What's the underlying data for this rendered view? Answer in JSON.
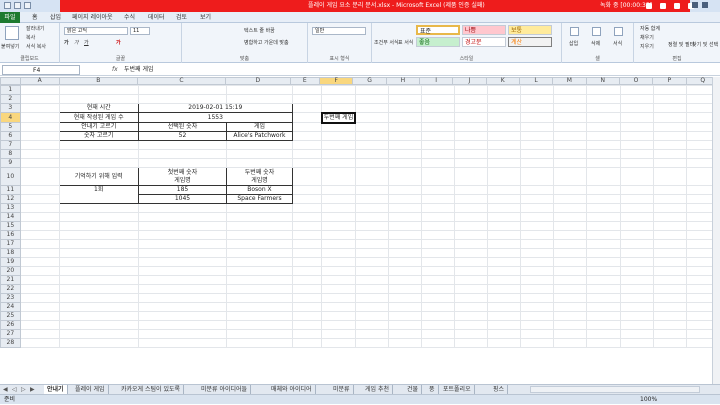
{
  "window": {
    "title": "플레이 게임 요소 분리 문서.xlsx  -  Microsoft Excel (제품 인증 실패)",
    "recording": "녹화 중 [00:00:35]"
  },
  "ribbon_tabs": [
    "파일",
    "홈",
    "삽입",
    "페이지 레이아웃",
    "수식",
    "데이터",
    "검토",
    "보기"
  ],
  "ribbon": {
    "clipboard": {
      "paste": "붙여넣기",
      "cut": "잘라내기",
      "copy": "복사",
      "format_painter": "서식 복사",
      "label": "클립보드"
    },
    "font": {
      "name": "맑은 고딕",
      "size": "11",
      "label": "글꼴"
    },
    "align": {
      "wrap": "텍스트 줄 바꿈",
      "merge": "병합하고 가운데 맞춤",
      "label": "맞춤"
    },
    "number": {
      "format": "일반",
      "label": "표시 형식"
    },
    "styles": {
      "cond": "조건부 서식",
      "table": "표 서식",
      "items": [
        "표준",
        "나쁨",
        "보통",
        "좋음",
        "경고문",
        "계산"
      ],
      "label": "스타일"
    },
    "cells": {
      "insert": "삽입",
      "delete": "삭제",
      "format": "서식",
      "label": "셀"
    },
    "edit": {
      "autosum": "자동 합계",
      "fill": "채우기",
      "clear": "지우기",
      "sort": "정렬 및 필터",
      "find": "찾기 및 선택",
      "label": "편집"
    }
  },
  "formula_bar": {
    "name_box": "F4",
    "fx": "fx",
    "value": "두번째 게임"
  },
  "columns": [
    "A",
    "B",
    "C",
    "D",
    "E",
    "F",
    "G",
    "H",
    "I",
    "J",
    "K",
    "L",
    "M",
    "N",
    "O",
    "P",
    "Q"
  ],
  "selected_column": "F",
  "selected_row": "4",
  "rows": {
    "r2": "2",
    "r3": "3",
    "r4": "4",
    "r5": "5",
    "r6": "6",
    "r10": "10",
    "r11": "11",
    "r12": "12"
  },
  "cells": {
    "B3": "현재 시간",
    "C3": "2019-02-01 15:19",
    "B4": "현재 작성된 게임 수",
    "C4": "1553",
    "B5": "안내기 고르기",
    "C5": "선택된 숫자",
    "D5": "게임",
    "B6": "숫자 고르기",
    "C6": "52",
    "D6": "Alice's Patchwork",
    "B10": "기억하기 위해 입력",
    "C10": "첫번째 숫자\n게임명",
    "D10": "두번째 숫자\n게임명",
    "B11": "1회",
    "C11": "185",
    "D11": "Boson X",
    "C12": "1045",
    "D12": "Space Farmers",
    "F4": "두번째 게임"
  },
  "sheet_tabs": [
    "안내기",
    "플레이 게임",
    "카카오게 스팀이 있도록",
    "미분류 아이디어들",
    "매체와 아이디어",
    "미분류",
    "게임 추천",
    "건물",
    "풍",
    "포트폴리오",
    "핑스"
  ],
  "status": {
    "ready": "준비",
    "zoom": "100%"
  }
}
